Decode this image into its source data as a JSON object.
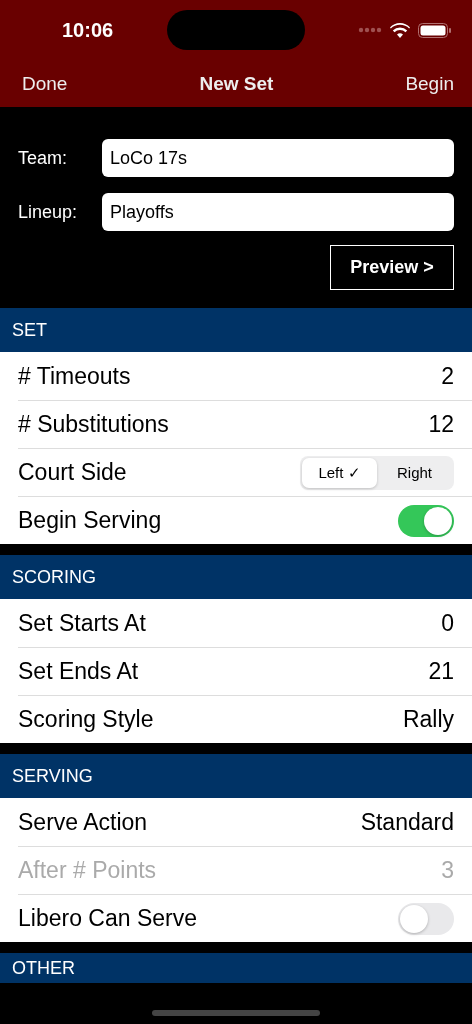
{
  "status_bar": {
    "time": "10:06"
  },
  "nav": {
    "left": "Done",
    "title": "New Set",
    "right": "Begin"
  },
  "form": {
    "fields": [
      {
        "label": "Team:",
        "value": "LoCo 17s"
      },
      {
        "label": "Lineup:",
        "value": "Playoffs"
      }
    ],
    "preview_button": "Preview >"
  },
  "sections": [
    {
      "title": "SET",
      "rows": [
        {
          "kind": "value",
          "label": "# Timeouts",
          "value": "2",
          "disabled": false
        },
        {
          "kind": "value",
          "label": "# Substitutions",
          "value": "12",
          "disabled": false
        },
        {
          "kind": "segmented",
          "label": "Court Side",
          "options": [
            {
              "label": "Left ✓",
              "selected": true
            },
            {
              "label": "Right",
              "selected": false
            }
          ]
        },
        {
          "kind": "toggle",
          "label": "Begin Serving",
          "on": true
        }
      ]
    },
    {
      "title": "SCORING",
      "rows": [
        {
          "kind": "value",
          "label": "Set Starts At",
          "value": "0",
          "disabled": false
        },
        {
          "kind": "value",
          "label": "Set Ends At",
          "value": "21",
          "disabled": false
        },
        {
          "kind": "value",
          "label": "Scoring Style",
          "value": "Rally",
          "disabled": false
        }
      ]
    },
    {
      "title": "SERVING",
      "rows": [
        {
          "kind": "value",
          "label": "Serve Action",
          "value": "Standard",
          "disabled": false
        },
        {
          "kind": "value",
          "label": "After # Points",
          "value": "3",
          "disabled": true
        },
        {
          "kind": "toggle",
          "label": "Libero Can Serve",
          "on": false
        }
      ]
    },
    {
      "title": "OTHER"
    }
  ]
}
